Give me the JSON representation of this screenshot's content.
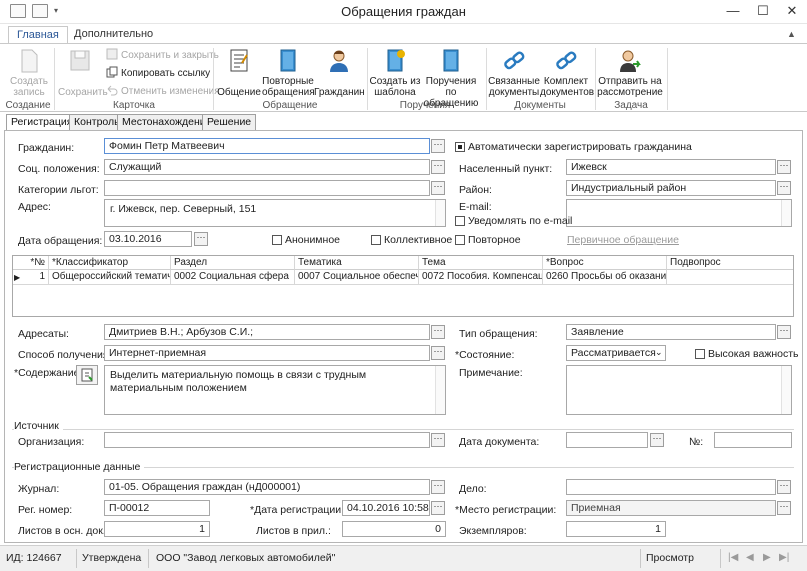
{
  "window": {
    "title": "Обращения граждан",
    "min": "—",
    "max": "☐",
    "close": "✕"
  },
  "ribbon_tabs": [
    "Главная",
    "Дополнительно"
  ],
  "ribbon": {
    "create": "Создать запись",
    "create_l1": "Создать",
    "create_l2": "запись",
    "save": "Сохранить",
    "save_close": "Сохранить и закрыть",
    "copy_link": "Копировать ссылку",
    "undo": "Отменить изменения",
    "obshenie": "Общение",
    "repeat_l1": "Повторные",
    "repeat_l2": "обращения",
    "citizens": "Гражданин",
    "from_tpl_l1": "Создать из",
    "from_tpl_l2": "шаблона",
    "orders_l1": "Поручения по",
    "orders_l2": "обращению",
    "linked_l1": "Связанные",
    "linked_l2": "документы",
    "kit_l1": "Комплект",
    "kit_l2": "документов",
    "send_l1": "Отправить на",
    "send_l2": "рассмотрение",
    "groups": {
      "create": "Создание",
      "card": "Карточка",
      "appeal": "Обращение",
      "orders": "Поручения",
      "docs": "Документы",
      "task": "Задача"
    }
  },
  "form_tabs": [
    "Регистрация",
    "Контроль",
    "Местонахождение",
    "Решение"
  ],
  "form": {
    "citizen_label": "Гражданин:",
    "citizen": "Фомин Петр Матвеевич",
    "auto_reg_label": "Автоматически зарегистрировать гражданина",
    "social_label": "Соц. положения:",
    "social": "Служащий",
    "locality_label": "Населенный пункт:",
    "locality": "Ижевск",
    "benefits_label": "Категории льгот:",
    "benefits": "",
    "district_label": "Район:",
    "district": "Индустриальный район",
    "address_label": "Адрес:",
    "address": "г. Ижевск, пер. Северный, 151",
    "email_label": "E-mail:",
    "email": "",
    "notify_label": "Уведомлять по e-mail",
    "date_label": "Дата обращения:",
    "date": "03.10.2016",
    "anon_label": "Анонимное",
    "collective_label": "Коллективное",
    "repeat_label": "Повторное",
    "primary_label": "Первичное обращение",
    "addressees_label": "Адресаты:",
    "addressees": "Дмитриев В.Н.; Арбузов С.И.;",
    "type_label": "Тип обращения:",
    "type": "Заявление",
    "method_label": "Способ получения:",
    "method": "Интернет-приемная",
    "state_label": "*Состояние:",
    "state": "Рассматривается",
    "high_label": "Высокая важность",
    "content_label": "*Содержание:",
    "content": "Выделить материальную помощь в связи с трудным материальным положением",
    "note_label": "Примечание:",
    "note": "",
    "source_title": "Источник",
    "org_label": "Организация:",
    "org": "",
    "doc_date_label": "Дата документа:",
    "doc_date": "",
    "num_label": "№:",
    "num": "",
    "reg_title": "Регистрационные данные",
    "journal_label": "Журнал:",
    "journal": "01-05. Обращения граждан (нД000001)",
    "case_label": "Дело:",
    "case": "",
    "regnum_label": "Рег. номер:",
    "regnum": "П-00012",
    "regdate_label": "*Дата регистрации:",
    "regdate": "04.10.2016 10:58:28",
    "regplace_label": "*Место регистрации:",
    "regplace": "Приемная",
    "sheets_label": "Листов в осн. док.:",
    "sheets": "1",
    "attach_label": "Листов в прил.:",
    "attach": "0",
    "copies_label": "Экземпляров:",
    "copies": "1"
  },
  "grid": {
    "headers": [
      "*№",
      "*Классификатор",
      "Раздел",
      "Тематика",
      "Тема",
      "*Вопрос",
      "Подвопрос"
    ],
    "rows": [
      [
        "1",
        "Общероссийский тематич...",
        "0002 Социальная сфера",
        "0007 Социальное обеспече...",
        "0072 Пособия. Компенсац...",
        "0260 Просьбы об оказании ...",
        ""
      ]
    ]
  },
  "status": {
    "id": "ИД: 124667",
    "state": "Утверждена",
    "org": "ООО \"Завод легковых автомобилей\"",
    "mode": "Просмотр"
  },
  "colors": {
    "accent": "#2b5797",
    "link_disabled": "#9a9a9a"
  }
}
